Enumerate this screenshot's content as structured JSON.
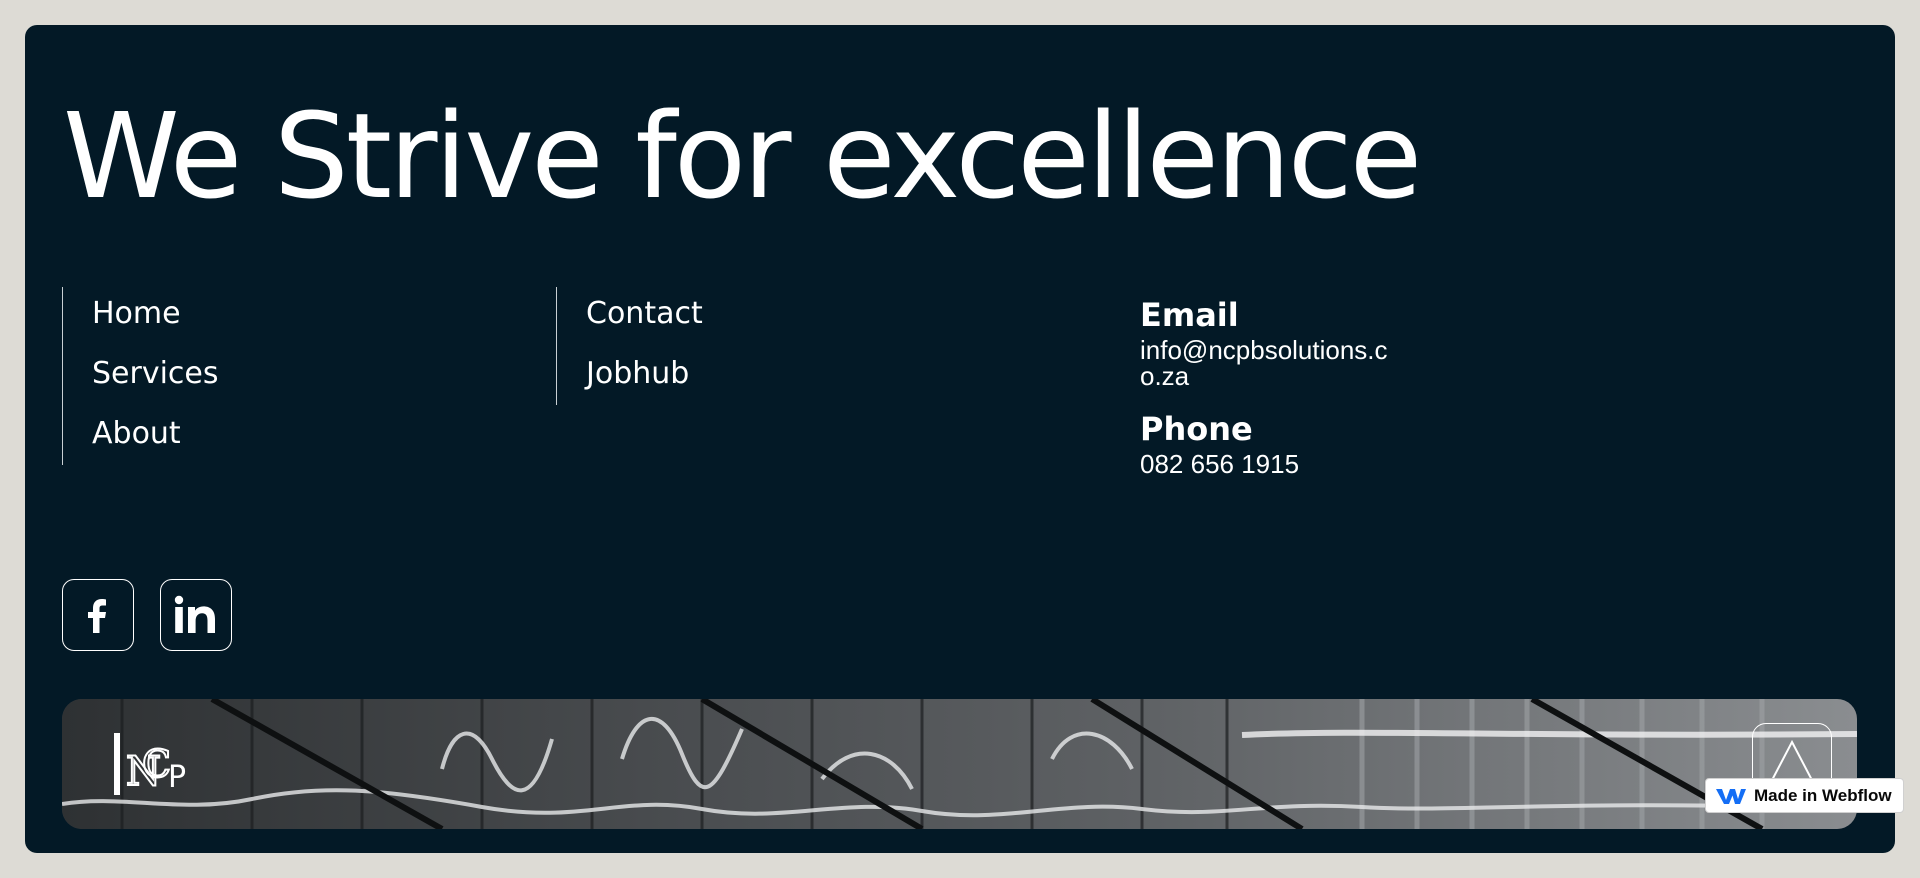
{
  "footer": {
    "headline": "We Strive for excellence",
    "nav_col1": [
      {
        "label": "Home"
      },
      {
        "label": "Services"
      },
      {
        "label": "About"
      }
    ],
    "nav_col2": [
      {
        "label": "Contact"
      },
      {
        "label": "Jobhub"
      }
    ],
    "contact": {
      "email_label": "Email",
      "email_value": "info@ncpbsolutions.co.za",
      "phone_label": "Phone",
      "phone_value": "082 656 1915"
    },
    "social": [
      {
        "icon": "facebook-icon",
        "glyph": "f"
      },
      {
        "icon": "linkedin-icon",
        "glyph": "in"
      }
    ],
    "banner": {
      "logo_text": "NCP",
      "back_to_top_icon": "triangle-up-icon"
    }
  },
  "badge": {
    "label": "Made in Webflow"
  },
  "colors": {
    "page_bg": "#dddbd5",
    "footer_bg": "#031926",
    "text": "#ffffff",
    "webflow_blue": "#146ef5"
  }
}
